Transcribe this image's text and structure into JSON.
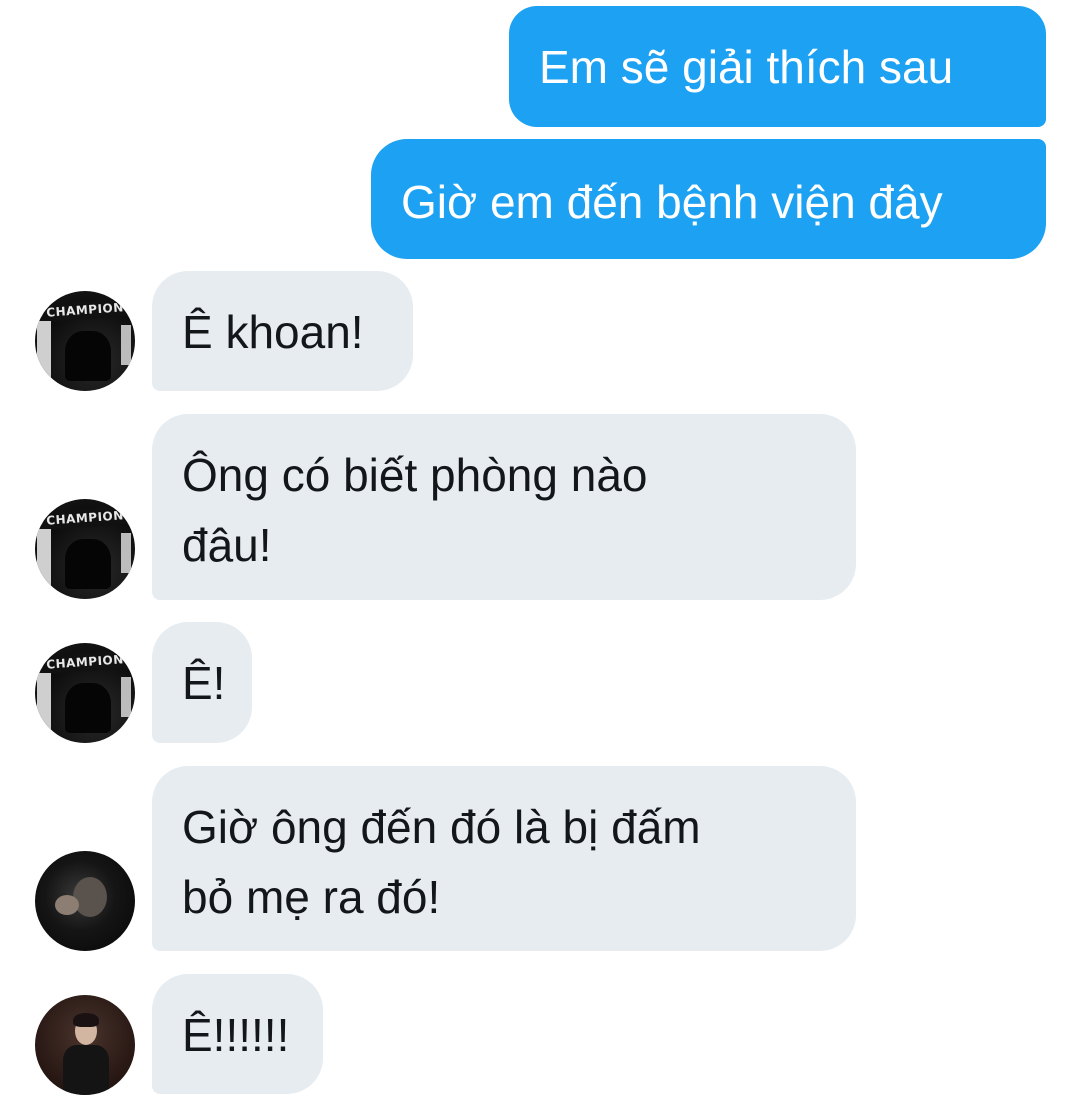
{
  "conversation": {
    "outgoing": [
      {
        "text": "Em sẽ giải thích sau"
      },
      {
        "text": "Giờ em đến bệnh viện đây"
      }
    ],
    "incoming": [
      {
        "lines": [
          "Ê khoan!"
        ],
        "avatar": "champion-avatar"
      },
      {
        "lines": [
          "Ông có biết phòng nào",
          "đâu!"
        ],
        "avatar": "champion-avatar"
      },
      {
        "lines": [
          "Ê!"
        ],
        "avatar": "champion-avatar"
      },
      {
        "lines": [
          "Giờ ông đến đó là bị đấm",
          "bỏ mẹ ra đó!"
        ],
        "avatar": "dark-avatar"
      },
      {
        "lines": [
          "Ê!!!!!!"
        ],
        "avatar": "brown-avatar"
      }
    ],
    "avatar_badge_text": "CHAMPION"
  },
  "colors": {
    "outgoing_bubble": "#1da1f2",
    "incoming_bubble": "#e6ecf0",
    "incoming_text": "#14171a",
    "outgoing_text": "#ffffff"
  }
}
